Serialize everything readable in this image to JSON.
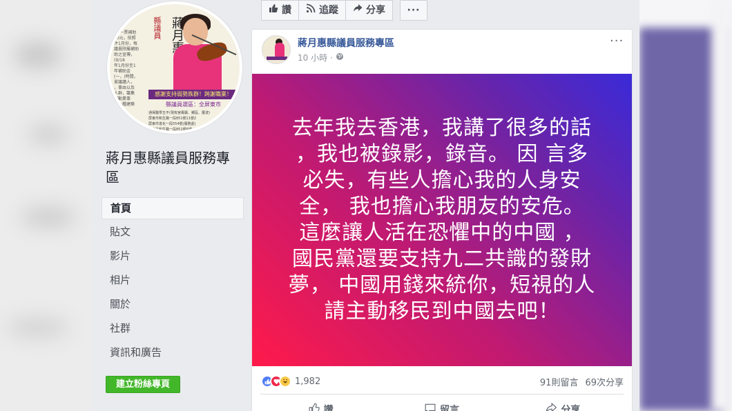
{
  "colors": {
    "page_bg": "#e9ebee",
    "link_blue": "#365899",
    "create_green": "#42b72a",
    "gradient": [
      "#ff1a4a",
      "#c01a72",
      "#6a24a8",
      "#3a2ad8"
    ]
  },
  "page": {
    "name": "蔣月惠縣議員服務專區",
    "avatar_poster": {
      "name_vertical": "蔣月惠",
      "title_vertical": "縣議員",
      "banner": "感謝支持弱勢族群！跨謝職業！",
      "sub_banner": "縣議員選區：全屏東市",
      "left_lines": [
        "4787",
        "(嗣一票補助",
        "00元，依照",
        "件1月份，每",
        "議員除屬補助",
        "助之宣傳，",
        "(9/18",
        "年1月份至1",
        "年補助金",
        "(一，(時間，",
        "單議講人，",
        "，事由以及",
        "人群，籌集",
        "補動業事",
        "，一種建築",
        "日費",
        "(身)障身",
        "、聲家同伴",
        "臥入數者",
        "電話"
      ],
      "bottom_lines": [
        "通保醫學五不(現有宮專廳、鄉區、厦波)",
        "屏東市和生路一段851號11號2",
        "屏東市逢化一段554號(服務處)",
        "屏東市和生路一段851號6號"
      ]
    }
  },
  "nav": {
    "items": [
      {
        "label": "首頁",
        "active": true
      },
      {
        "label": "貼文",
        "active": false
      },
      {
        "label": "影片",
        "active": false
      },
      {
        "label": "相片",
        "active": false
      },
      {
        "label": "關於",
        "active": false
      },
      {
        "label": "社群",
        "active": false
      },
      {
        "label": "資訊和廣告",
        "active": false
      }
    ],
    "create_button": "建立粉絲專頁"
  },
  "actions": {
    "like": "讚",
    "follow": "追蹤",
    "share": "分享",
    "more": "···"
  },
  "post": {
    "author": "蔣月惠縣議員服務專區",
    "time": "10 小時",
    "menu": "···",
    "text": "去年我去香港，我講了很多的話\n，我也被錄影，錄音。 因 言多\n必失，有些人擔心我的人身安\n全， 我也擔心我朋友的安危。\n這麼讓人活在恐懼中的中國 ，\n國民黨還要支持九二共識的發財\n夢， 中國用錢來統你，短視的人\n請主動移民到中國去吧！",
    "reactions_count": "1,982",
    "comments": "91則留言",
    "shares": "69次分享",
    "footer": {
      "like": "讚",
      "comment": "留言",
      "share": "分享"
    }
  }
}
